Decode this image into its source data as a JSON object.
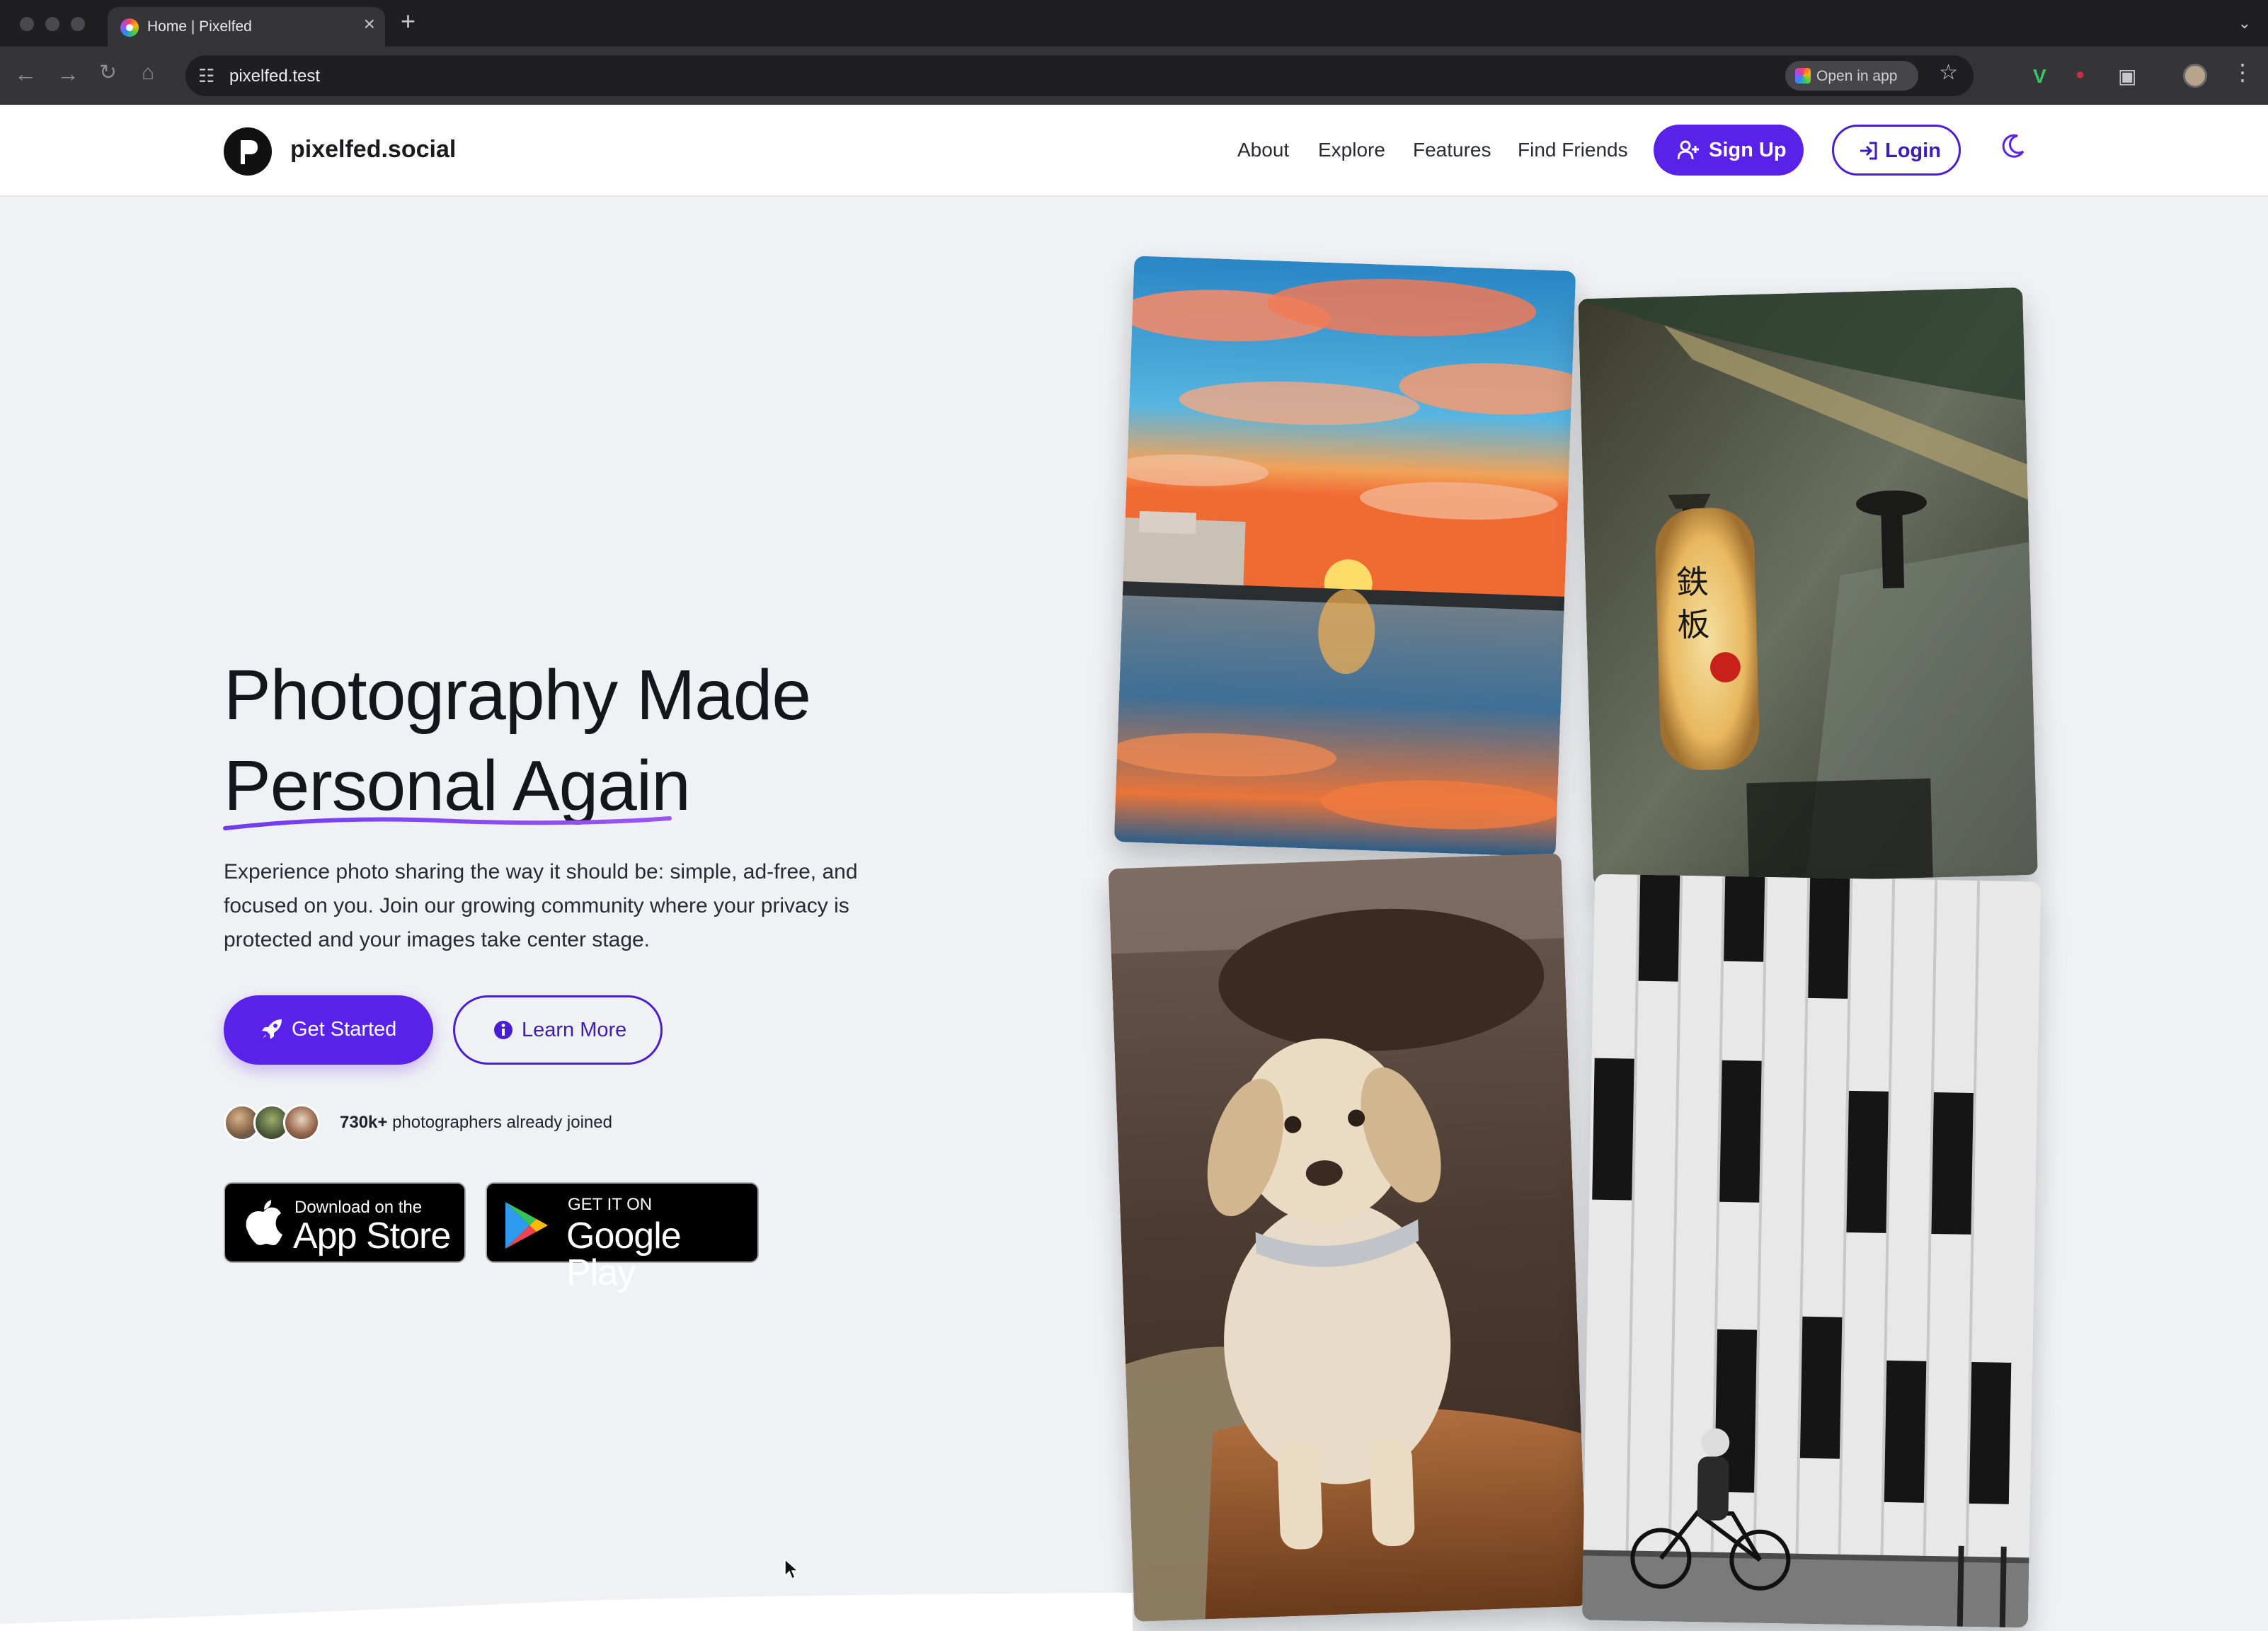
{
  "browser": {
    "tab_title": "Home | Pixelfed",
    "tab_close": "×",
    "new_tab": "+",
    "url": "pixelfed.test",
    "open_in_app": "Open in app"
  },
  "site": {
    "logo_text": "pixelfed.social",
    "nav": [
      {
        "label": "About"
      },
      {
        "label": "Explore"
      },
      {
        "label": "Features"
      },
      {
        "label": "Find Friends"
      }
    ],
    "signup_label": "Sign Up",
    "login_label": "Login"
  },
  "hero": {
    "title_line1": "Photography Made",
    "title_line2": "Personal Again",
    "description": "Experience photo sharing the way it should be: simple, ad-free, and focused on you. Join our growing community where your privacy is protected and your images take center stage.",
    "get_started_label": "Get Started",
    "learn_more_label": "Learn More",
    "joined_count": "730k+",
    "joined_text": " photographers already joined"
  },
  "stores": {
    "apple_small": "Download on the",
    "apple_big": "App Store",
    "google_small": "GET IT ON",
    "google_big": "Google Play"
  },
  "colors": {
    "accent": "#5a21e8",
    "accent_dark": "#3c1db8",
    "page_bg": "#f0f1f4"
  },
  "icons": {
    "signup": "user-plus-icon",
    "login": "login-arrow-icon",
    "theme": "moon-icon",
    "get_started": "rocket-icon",
    "learn_more": "info-circle-icon"
  }
}
